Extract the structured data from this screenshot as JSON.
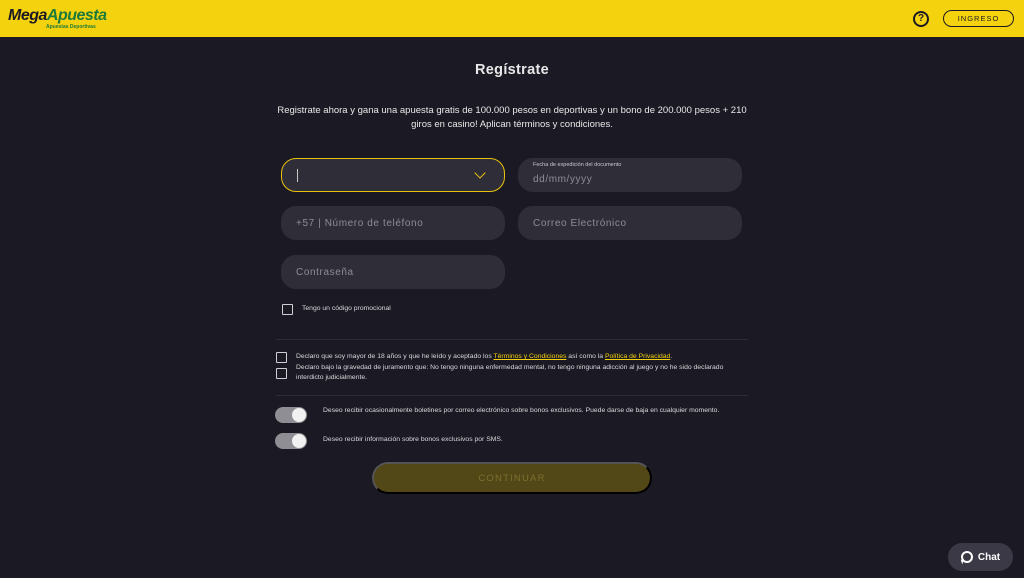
{
  "header": {
    "logo_mega": "Mega",
    "logo_apuesta": "Apuesta",
    "logo_sub": "Apuestas Deportivas",
    "help_symbol": "?",
    "login_label": "INGRESO",
    "background": "#f5d20e"
  },
  "page": {
    "title": "Regístrate",
    "promo_text": "Registrate ahora y gana una apuesta gratis de 100.000 pesos en deportivas y un bono de 200.000 pesos + 210 giros en casino! Aplican términos y condiciones."
  },
  "form": {
    "document_type": {
      "value": "",
      "icon": "chevron-down-icon"
    },
    "expedition_date": {
      "label": "Fecha de expedición del documento",
      "placeholder": "dd/mm/yyyy"
    },
    "phone": {
      "placeholder": "+57 | Número de teléfono"
    },
    "email": {
      "placeholder": "Correo Electrónico"
    },
    "password": {
      "placeholder": "Contraseña"
    },
    "promo_code_label": "Tengo un código promocional"
  },
  "declarations": {
    "age_prefix": "Declaro que soy mayor de 18 años y que he leído y aceptado los ",
    "terms_link": "Términos y Condiciones",
    "age_middle": " así como la ",
    "privacy_link": "Política de Privacidad",
    "age_suffix": ".",
    "oath": "Declaro bajo la gravedad de juramento que: No tengo ninguna enfermedad mental, no tengo ninguna adicción al juego y no he sido declarado interdicto judicialmente."
  },
  "preferences": {
    "email_newsletter": "Deseo recibir ocasionalmente boletines por correo electrónico sobre bonos exclusivos. Puede darse de baja en cualquier momento.",
    "sms": "Deseo recibir información sobre bonos exclusivos por SMS."
  },
  "actions": {
    "continue_label": "CONTINUAR",
    "chat_label": "Chat"
  },
  "colors": {
    "accent": "#f5d20e",
    "background": "#1b1a24",
    "field": "#2f2e38"
  }
}
